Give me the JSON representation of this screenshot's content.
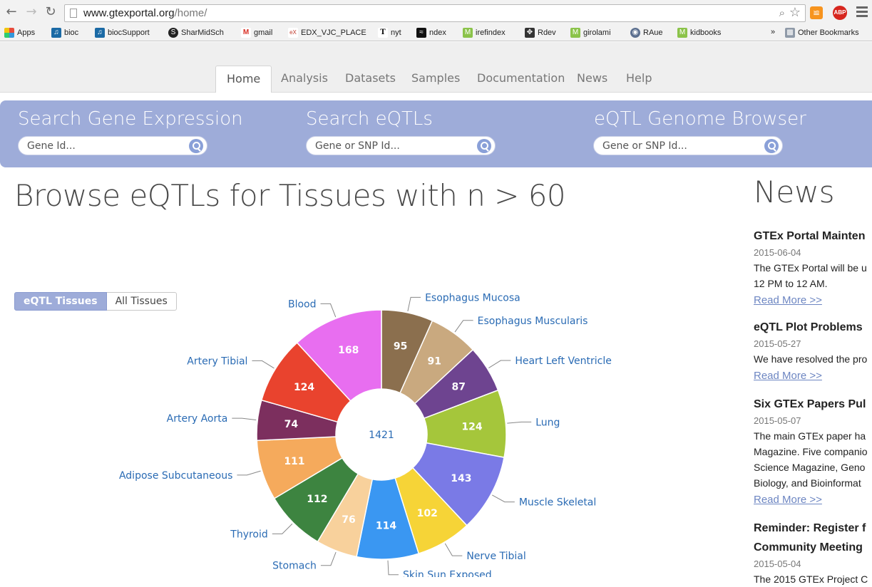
{
  "browser": {
    "url_host": "www.gtexportal.org",
    "url_path": "/home/",
    "bookmarks": [
      "Apps",
      "bioc",
      "biocSupport",
      "SharMidSch",
      "gmail",
      "EDX_VJC_PLACE",
      "nyt",
      "ndex",
      "irefindex",
      "Rdev",
      "girolami",
      "RAue",
      "kidbooks"
    ],
    "more": "»",
    "other_bookmarks": "Other Bookmarks",
    "rss_label": "RSS",
    "abp_label": "ABP"
  },
  "nav": {
    "tabs": [
      "Home",
      "Analysis",
      "Datasets",
      "Samples",
      "Documentation",
      "News",
      "Help"
    ],
    "active": "Home"
  },
  "search": {
    "gene_expression": {
      "title": "Search Gene Expression",
      "placeholder": "Gene Id..."
    },
    "eqtls": {
      "title": "Search eQTLs",
      "placeholder": "Gene or SNP Id..."
    },
    "genome_browser": {
      "title": "eQTL Genome Browser",
      "placeholder": "Gene or SNP Id..."
    }
  },
  "main": {
    "title": "Browse eQTLs for Tissues with n > 60",
    "toggle": {
      "on": "eQTL Tissues",
      "off": "All Tissues"
    }
  },
  "chart_data": {
    "type": "pie",
    "style": "donut",
    "center_label": "1421",
    "slices": [
      {
        "label": "Esophagus Mucosa",
        "value": 95,
        "color": "#8b6f4e"
      },
      {
        "label": "Esophagus Muscularis",
        "value": 91,
        "color": "#c9a97f"
      },
      {
        "label": "Heart Left Ventricle",
        "value": 87,
        "color": "#6e4490"
      },
      {
        "label": "Lung",
        "value": 124,
        "color": "#a5c63b"
      },
      {
        "label": "Muscle Skeletal",
        "value": 143,
        "color": "#7a7ae6"
      },
      {
        "label": "Nerve Tibial",
        "value": 102,
        "color": "#f6d437"
      },
      {
        "label": "Skin Sun Exposed",
        "value": 114,
        "color": "#3a97f2"
      },
      {
        "label": "Stomach",
        "value": 76,
        "color": "#f8d19c"
      },
      {
        "label": "Thyroid",
        "value": 112,
        "color": "#3d8440"
      },
      {
        "label": "Adipose Subcutaneous",
        "value": 111,
        "color": "#f5aa5c"
      },
      {
        "label": "Artery Aorta",
        "value": 74,
        "color": "#7c2f5e"
      },
      {
        "label": "Artery Tibial",
        "value": 124,
        "color": "#e9432e"
      },
      {
        "label": "Blood",
        "value": 168,
        "color": "#e86ef0"
      }
    ]
  },
  "news": {
    "heading": "News",
    "items": [
      {
        "title": "GTEx Portal Mainten",
        "date": "2015-06-04",
        "body": [
          "The GTEx Portal will be u",
          "12 PM to 12 AM."
        ],
        "more": "Read More >>"
      },
      {
        "title": "eQTL Plot Problems",
        "date": "2015-05-27",
        "body": [
          "We have resolved the pro"
        ],
        "more": "Read More >>"
      },
      {
        "title": "Six GTEx Papers Pul",
        "date": "2015-05-07",
        "body": [
          "The main GTEx paper ha",
          "Magazine. Five companio",
          "Science Magazine, Geno",
          "Biology, and Bioinformat"
        ],
        "more": "Read More >>"
      },
      {
        "title": "Reminder: Register f",
        "title2": "Community Meeting",
        "date": "2015-05-04",
        "body": [
          "The 2015 GTEx Project C"
        ],
        "more": ""
      }
    ]
  }
}
